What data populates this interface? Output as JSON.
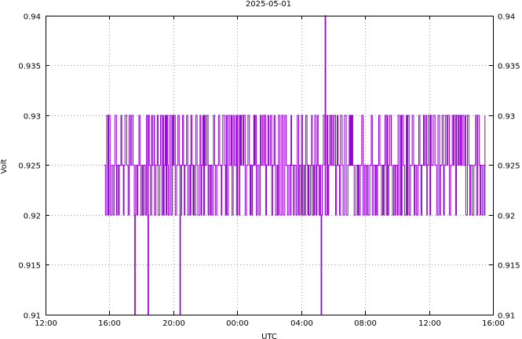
{
  "chart_data": {
    "type": "line",
    "title": "2025-05-01",
    "xlabel": "UTC",
    "ylabel": "Volt",
    "x_ticks": [
      "12:00",
      "16:00",
      "20:00",
      "00:00",
      "04:00",
      "08:00",
      "12:00",
      "16:00"
    ],
    "x_range": [
      "2025-04-30 12:00",
      "2025-05-01 16:00"
    ],
    "y_ticks": [
      "0.91",
      "0.915",
      "0.92",
      "0.925",
      "0.93",
      "0.935",
      "0.94"
    ],
    "ylim": [
      0.91,
      0.94
    ],
    "right_axis": true,
    "grid": true,
    "line_color": "#9400d3",
    "series": [
      {
        "x_start": "2025-04-30 15:40",
        "x_end": "2025-05-01 15:30",
        "values_range": [
          0.92,
          0.93
        ],
        "levels": [
          0.92,
          0.925,
          0.93
        ],
        "dips": [
          {
            "x": "2025-04-30 17:35",
            "y": 0.91
          },
          {
            "x": "2025-04-30 18:25",
            "y": 0.91
          },
          {
            "x": "2025-04-30 20:25",
            "y": 0.91
          },
          {
            "x": "2025-05-01 05:15",
            "y": 0.91
          }
        ],
        "spikes": [
          {
            "x": "2025-05-01 05:30",
            "y": 0.94
          }
        ]
      }
    ]
  }
}
